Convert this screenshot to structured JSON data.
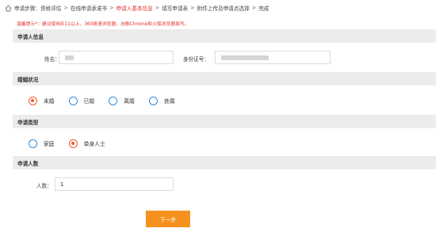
{
  "breadcrumb": {
    "items": [
      {
        "label": "申请步骤：资格评估"
      },
      {
        "label": "在线申请承诺书"
      },
      {
        "label": "申请人基本信息"
      },
      {
        "label": "填写申请表"
      },
      {
        "label": "附件上传及申请点选择"
      },
      {
        "label": "完成"
      }
    ],
    "active_index": 2,
    "separator": ">"
  },
  "tip": {
    "label": "温馨提示*：",
    "text": "建议使用IE11以上、360极速浏览器、谷歌Chrome和火狐浏览器填写。"
  },
  "applicant_info": {
    "title": "申请人信息",
    "name_label": "姓名：",
    "name_value": "",
    "id_label": "身份证号：",
    "id_value": ""
  },
  "marital_status": {
    "title": "婚姻状况",
    "options": [
      "未婚",
      "已婚",
      "离婚",
      "丧偶"
    ],
    "selected": "未婚"
  },
  "apply_type": {
    "title": "申请类型",
    "options": [
      "家庭",
      "单身人士"
    ],
    "selected": "单身人士"
  },
  "applicant_count": {
    "title": "申请人数",
    "label": "人数：",
    "value": "1"
  },
  "next_button": {
    "label": "下一步"
  },
  "colors": {
    "accent_red": "#e52f2f",
    "radio_blue": "#2d8ce0",
    "radio_checked": "#ef5a2f",
    "button_orange": "#f6911f",
    "section_bg": "#ececec"
  }
}
